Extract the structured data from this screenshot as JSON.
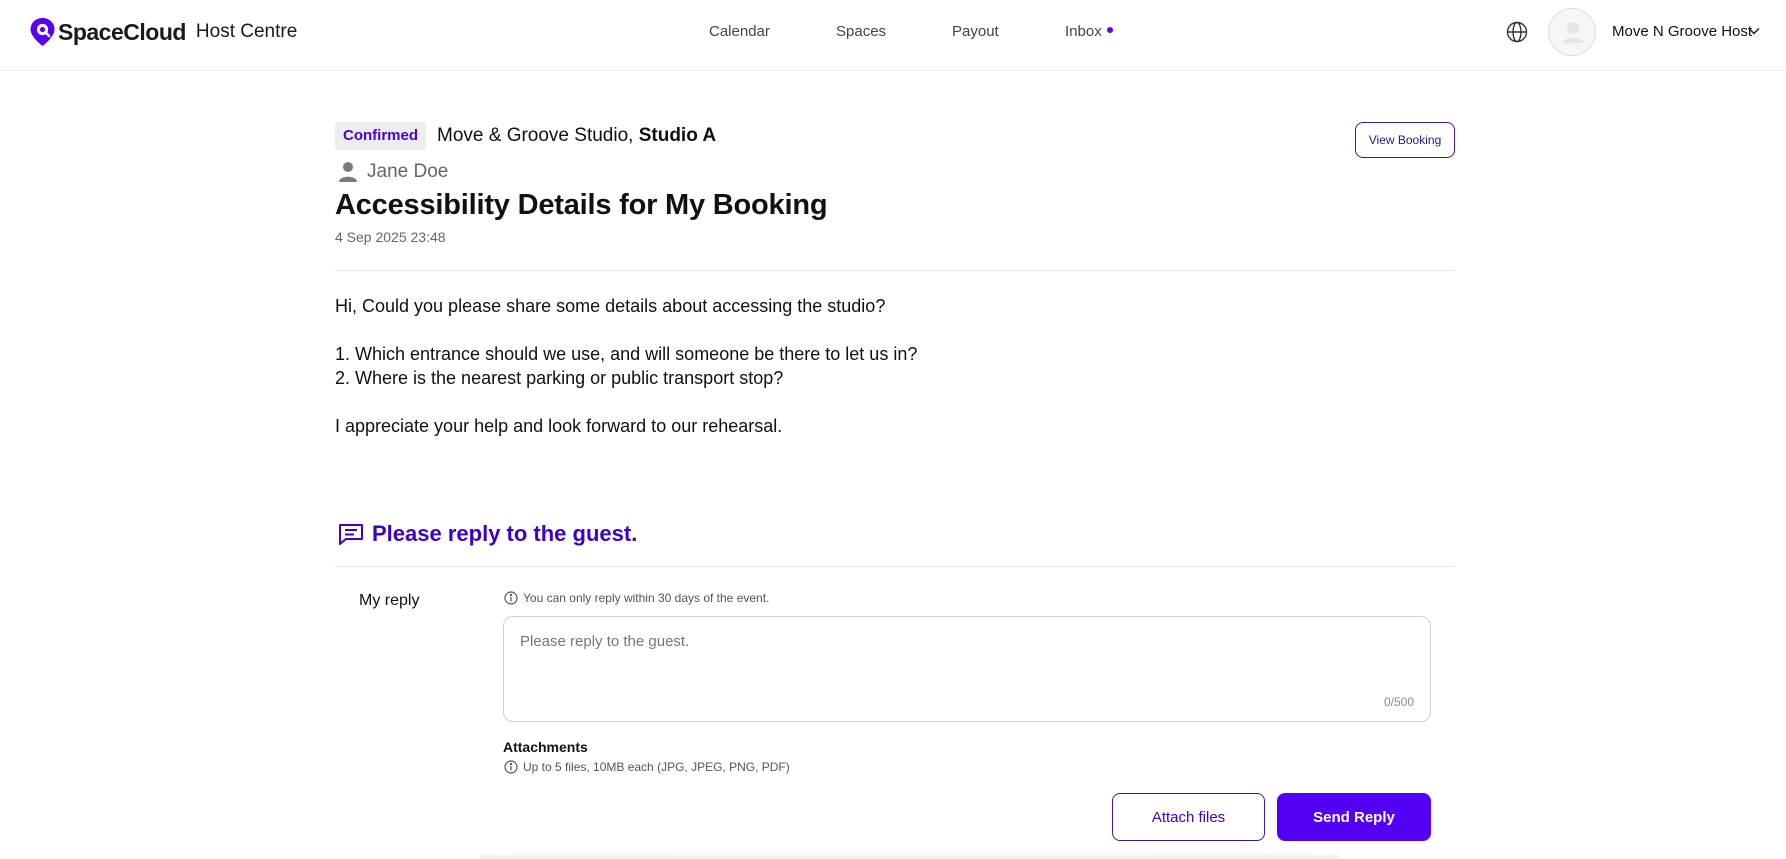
{
  "header": {
    "brand": "SpaceCloud",
    "section": "Host Centre",
    "nav": [
      {
        "label": "Calendar"
      },
      {
        "label": "Spaces"
      },
      {
        "label": "Payout"
      },
      {
        "label": "Inbox",
        "has_unread_dot": true
      }
    ],
    "host_name": "Move N Groove Host"
  },
  "booking": {
    "status": "Confirmed",
    "venue_name": "Move & Groove Studio,",
    "room_name": "Studio A",
    "view_booking_label": "View Booking",
    "guest_name": "Jane Doe"
  },
  "message": {
    "title": "Accessibility Details for My Booking",
    "date": "4 Sep 2025 23:48",
    "lines": [
      "Hi, Could you please share some details about accessing the studio?",
      "1. Which entrance should we use, and will someone be there to let us in?",
      "2. Where is the nearest parking or public transport stop?",
      "I appreciate your help and look forward to our rehearsal."
    ]
  },
  "reply": {
    "section_title": "Please reply to the guest.",
    "label": "My reply",
    "notice": "You can only reply within 30 days of the event.",
    "placeholder": "Please reply to the guest.",
    "counter": "0/500",
    "attachments_title": "Attachments",
    "attachments_hint": "Up to 5 files, 10MB each (JPG, JPEG, PNG, PDF)",
    "attach_label": "Attach files",
    "send_label": "Send Reply"
  },
  "colors": {
    "accent": "#5300f5",
    "accent_text": "#3d00c4",
    "badge_bg": "#ededed"
  }
}
